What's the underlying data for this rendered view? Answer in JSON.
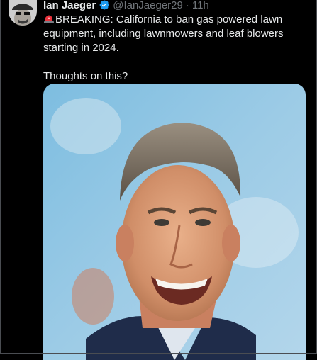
{
  "tweet": {
    "author_name": "Ian Jaeger",
    "handle": "@IanJaeger29",
    "separator": "·",
    "time": "11h",
    "text_line1": "BREAKING: California to ban gas powered lawn equipment, including lawnmowers and leaf blowers starting in 2024.",
    "text_line2": "Thoughts on this?"
  },
  "icons": {
    "verified": "verified-badge-icon",
    "siren": "rotating-light-emoji"
  },
  "colors": {
    "background": "#000000",
    "text": "#e7e9ea",
    "muted": "#71767b",
    "verified": "#1d9bf0",
    "siren": "#e8323c"
  }
}
